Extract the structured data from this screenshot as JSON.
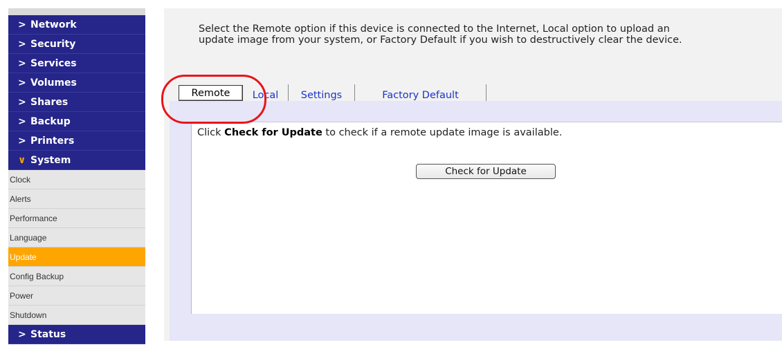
{
  "sidebar": {
    "top_items": [
      {
        "label": "Network",
        "chevron": ">"
      },
      {
        "label": "Security",
        "chevron": ">"
      },
      {
        "label": "Services",
        "chevron": ">"
      },
      {
        "label": "Volumes",
        "chevron": ">"
      },
      {
        "label": "Shares",
        "chevron": ">"
      },
      {
        "label": "Backup",
        "chevron": ">"
      },
      {
        "label": "Printers",
        "chevron": ">"
      },
      {
        "label": "System",
        "chevron": "∨"
      }
    ],
    "sub_items": [
      {
        "label": "Clock"
      },
      {
        "label": "Alerts"
      },
      {
        "label": "Performance"
      },
      {
        "label": "Language"
      },
      {
        "label": "Update"
      },
      {
        "label": "Config Backup"
      },
      {
        "label": "Power"
      },
      {
        "label": "Shutdown"
      }
    ],
    "bottom_item": {
      "label": "Status",
      "chevron": ">"
    },
    "active_sub": "Update",
    "colors": {
      "nav_bg": "#25258a",
      "active_bg": "#ffa500",
      "sub_bg": "#e6e6e6"
    }
  },
  "main": {
    "intro_line1": "Select the Remote option if this device is connected to the Internet, Local option to upload an",
    "intro_line2": "update image from your system, or Factory Default if you wish to destructively clear the device.",
    "tabs": [
      {
        "label": "Remote"
      },
      {
        "label": "Local"
      },
      {
        "label": "Settings"
      },
      {
        "label": "Factory Default"
      }
    ],
    "selected_tab": "Remote",
    "message_prefix": "Click ",
    "message_bold": "Check for Update",
    "message_suffix": " to check if a remote update image is available.",
    "check_button": "Check for Update"
  },
  "annotation": {
    "color": "#e8141a"
  }
}
